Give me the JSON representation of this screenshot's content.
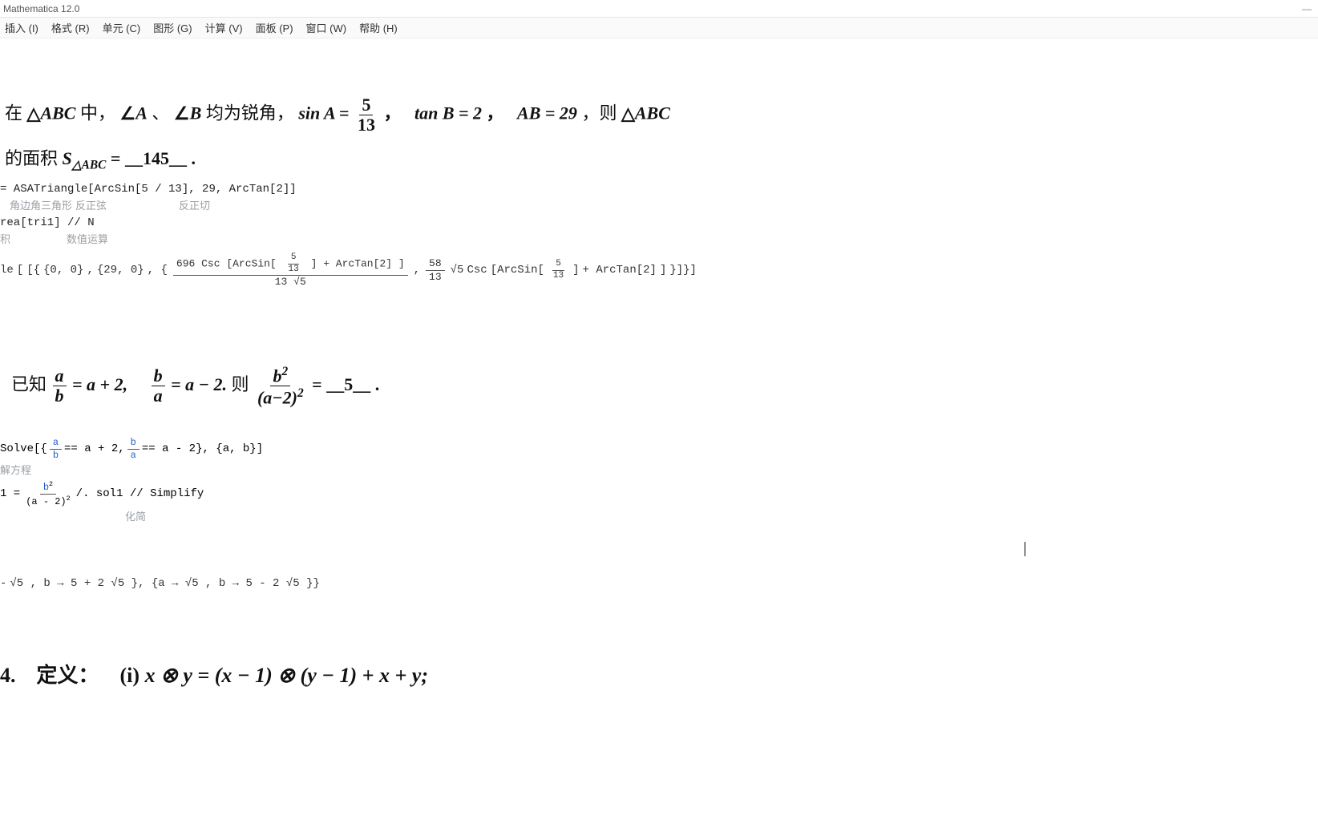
{
  "window": {
    "title": "Mathematica 12.0",
    "minimize": "—"
  },
  "menu": {
    "insert": "插入 (I)",
    "format": "格式 (R)",
    "cell": "单元 (C)",
    "graphics": "图形 (G)",
    "compute": "计算 (V)",
    "panel": "面板 (P)",
    "window": "窗口 (W)",
    "help": "帮助 (H)"
  },
  "problem1": {
    "prefix": "在 ",
    "tri_abc": "ABC",
    "mid1": " 中，",
    "angA": "A",
    "sep_dot": "、",
    "angB": "B",
    "mid2": " 均为锐角，",
    "sinA": "sin A = ",
    "f_num": "5",
    "f_den": "13",
    "comma1": "，",
    "tanB": "tan B = 2",
    "comma2": "，",
    "ab": "AB = 29",
    "comma3": "，则 ",
    "line2a": "的面积 ",
    "Ssub": "△ABC",
    "eq": " = ",
    "answer": "145",
    "period": "."
  },
  "cell1": {
    "code": "= ASATriangle[ArcSin[5 / 13], 29, ArcTan[2]]",
    "hint_left": "角边角三角形",
    "hint_mid": "反正弦",
    "hint_right": "反正切"
  },
  "cell2": {
    "code": "rea[tri1] // N",
    "hint_left": "积",
    "hint_right": "数值运算"
  },
  "outputMath": {
    "lead": "le",
    "open": "[{",
    "p1": "{0, 0}",
    "p2": "{29, 0}",
    "bigfrac_num_a": "696 Csc",
    "bigfrac_inner_num": "5",
    "bigfrac_inner_den": "13",
    "bigfrac_num_b": " + ArcTan[2]",
    "bigfrac_den": "13 √5",
    "comma": ",",
    "f2_num": "58",
    "f2_den": "13",
    "sqrt5": "√5",
    "csc": " Csc",
    "inner2_num": "5",
    "inner2_den": "13",
    "tail": " + ArcTan[2]",
    "close": "}]}]"
  },
  "problem2": {
    "lead": "已知 ",
    "f1_num": "a",
    "f1_den": "b",
    "eq1": " = a + 2,",
    "f2_num": "b",
    "f2_den": "a",
    "eq2": " = a − 2.",
    "then": "  则  ",
    "f3_num": "b",
    "f3_sup": "2",
    "f3_den": "(a−2)",
    "f3_den_sup": "2",
    "eq3": "  =  ",
    "answer": "5",
    "period": "."
  },
  "cell3": {
    "lead": "Solve",
    "vars_a": "a",
    "vars_b": "b",
    "eq1": " == a + 2, ",
    "eq2": " == a - 2",
    "varset": ", {a, b}",
    "hint": "解方程"
  },
  "cell4": {
    "lhs": "1 = ",
    "num_b": "b",
    "num_sup": "2",
    "den": "(a - 2)",
    "den_sup": "2",
    "tail": " /. sol1 // Simplify",
    "hint": "化简"
  },
  "output2": {
    "part1": "√5 , b → 5 + 2 √5 }, {a → √5 , b → 5 - 2 √5 }}"
  },
  "problem3": {
    "num": "4.",
    "lead": "定义：",
    "sub_i": "(i)",
    "expr": " x ⊗ y = (x − 1) ⊗ (y − 1) + x + y;"
  }
}
